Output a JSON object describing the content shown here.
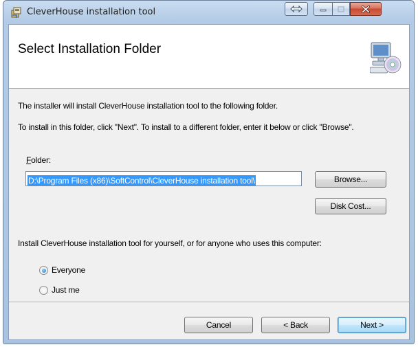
{
  "window": {
    "title": "CleverHouse installation tool"
  },
  "banner": {
    "title": "Select Installation Folder",
    "icon": "computer-cd-icon"
  },
  "body": {
    "intro": "The installer will install CleverHouse installation tool to the following folder.",
    "instructions": "To install in this folder, click \"Next\". To install to a different folder, enter it below or click \"Browse\".",
    "folder_label_accel": "F",
    "folder_label_rest": "older:",
    "folder_value": "D:\\Program Files (x86)\\SoftControl\\CleverHouse installation tool\\",
    "browse_label": "Browse...",
    "disk_cost_label": "Disk Cost...",
    "install_for_prompt": "Install CleverHouse installation tool for yourself, or for anyone who uses this computer:",
    "radio_everyone": "Everyone",
    "radio_just_me": "Just me",
    "selected_option": "Everyone"
  },
  "footer": {
    "cancel_label": "Cancel",
    "back_label": "< Back",
    "next_label": "Next >"
  }
}
